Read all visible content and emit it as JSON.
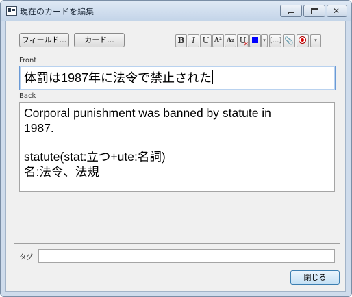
{
  "window": {
    "title": "現在のカードを編集",
    "close_glyph": "✕"
  },
  "toolbar": {
    "fields_button": "フィールド...",
    "cards_button": "カード...",
    "format": {
      "bold": "B",
      "italic": "I",
      "underline": "U",
      "superscript": "A²",
      "subscript": "A₂",
      "clear_formatting": "U",
      "text_color": "#0000ff",
      "color_dropdown": "▾",
      "cloze": "[...]",
      "attach": "📎",
      "more": "▾"
    }
  },
  "fields": {
    "front": {
      "label": "Front",
      "value": "体罰は1987年に法令で禁止された"
    },
    "back": {
      "label": "Back",
      "lines": [
        "Corporal punishment was banned by statute in",
        "1987.",
        "statute(stat:立つ+ute:名詞)",
        "名:法令、法規"
      ]
    }
  },
  "tags": {
    "label": "タグ",
    "value": ""
  },
  "footer": {
    "close_button": "閉じる"
  }
}
